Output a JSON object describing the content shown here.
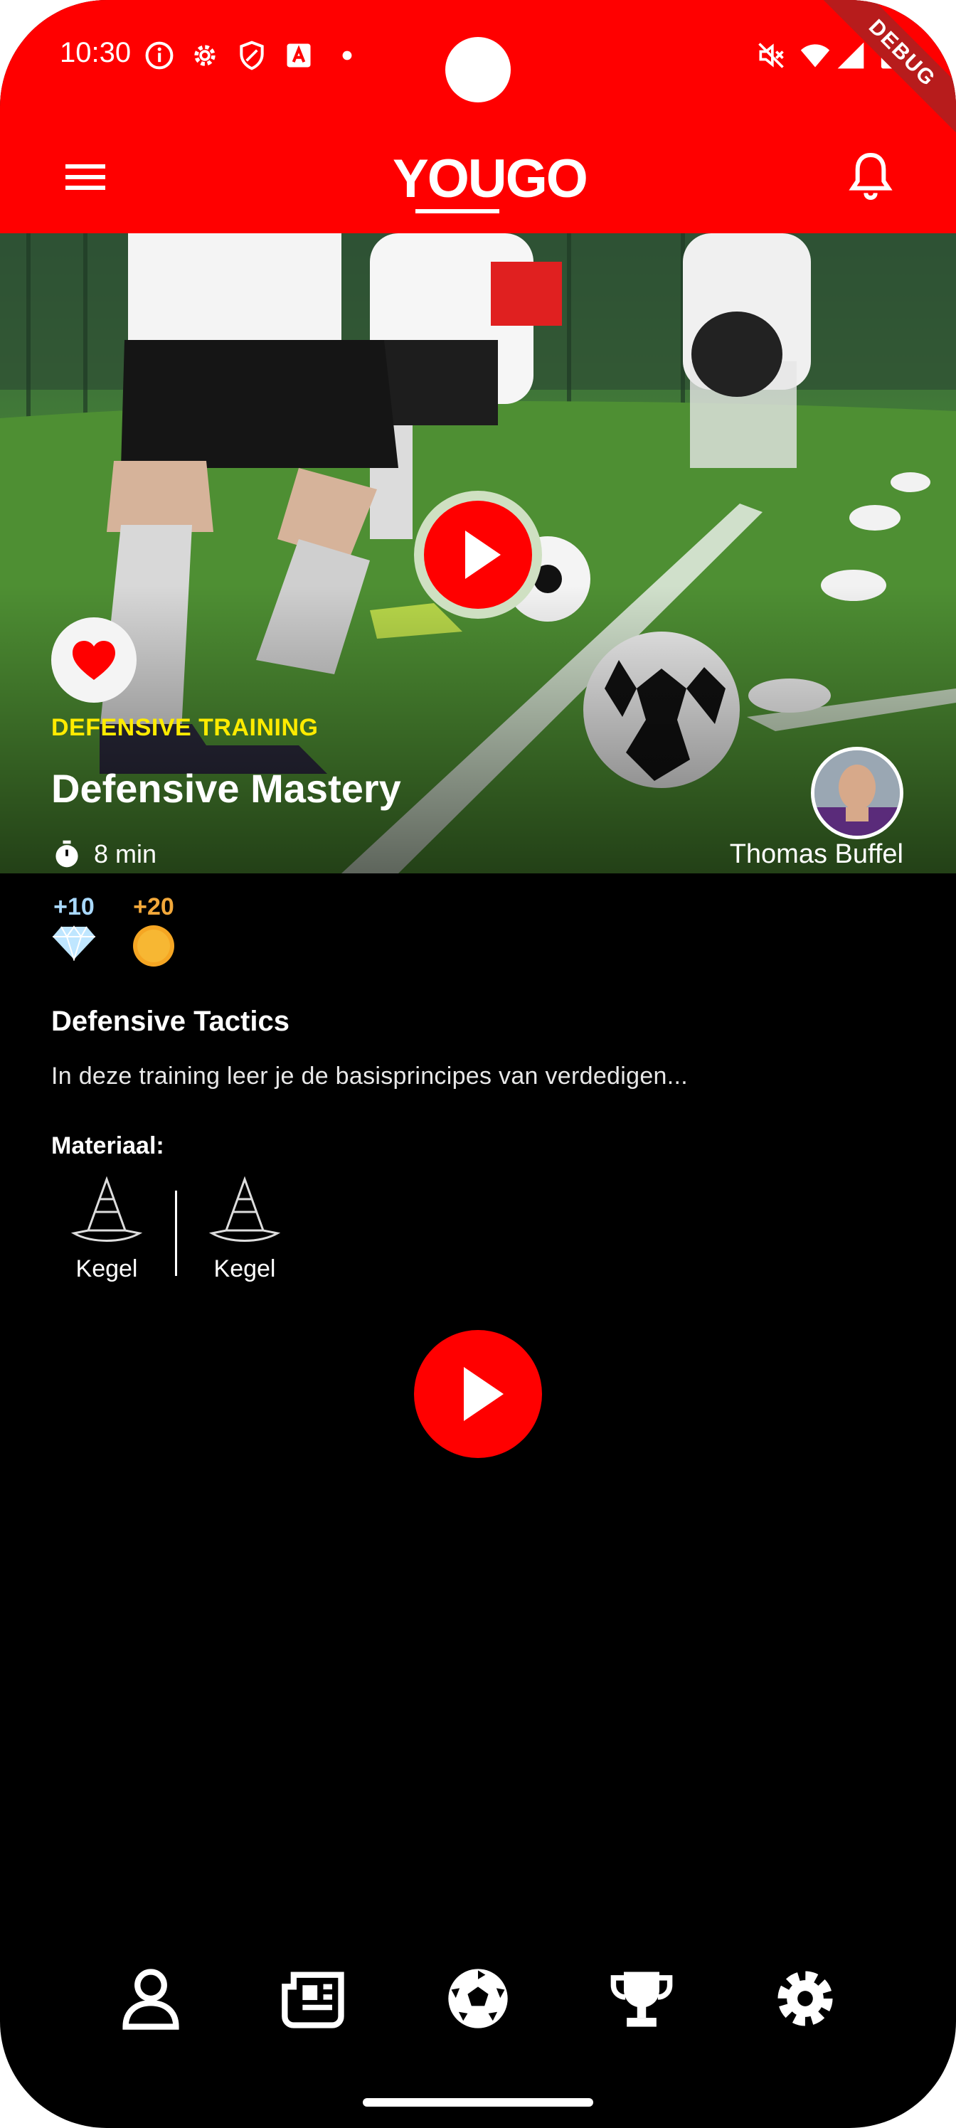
{
  "status_bar": {
    "time": "10:30",
    "debug_banner": "DEBUG",
    "icons": [
      "info-icon",
      "gear-icon",
      "shield-icon",
      "app-icon",
      "dot-icon",
      "mute-icon",
      "wifi-icon",
      "signal-icon",
      "battery-icon"
    ]
  },
  "app_bar": {
    "logo": "YOUGO",
    "menu_icon": "menu-icon",
    "bell_icon": "bell-icon"
  },
  "hero": {
    "category": "DEFENSIVE TRAINING",
    "title": "Defensive Mastery",
    "duration": "8 min",
    "coach_name": "Thomas Buffel",
    "favorite": true
  },
  "rewards": [
    {
      "value": "+10",
      "icon": "diamond-icon",
      "color": "#a9d9ff"
    },
    {
      "value": "+20",
      "icon": "coin-icon",
      "color": "#f2a83a"
    }
  ],
  "content": {
    "section_title": "Defensive Tactics",
    "description": "In deze training leer je de basisprincipes van verdedigen...",
    "materials_title": "Materiaal:",
    "materials": [
      {
        "label": "Kegel",
        "icon": "cone-icon"
      },
      {
        "label": "Kegel",
        "icon": "cone-icon"
      }
    ]
  },
  "bottom_nav": {
    "items": [
      {
        "name": "profile",
        "icon": "person-icon"
      },
      {
        "name": "news",
        "icon": "newspaper-icon"
      },
      {
        "name": "trainings",
        "icon": "soccer-ball-icon"
      },
      {
        "name": "rankings",
        "icon": "trophy-icon"
      },
      {
        "name": "settings",
        "icon": "gear-icon"
      }
    ]
  },
  "colors": {
    "brand_red": "#ff0000",
    "category_yellow": "#ffeb00",
    "background": "#000000"
  }
}
